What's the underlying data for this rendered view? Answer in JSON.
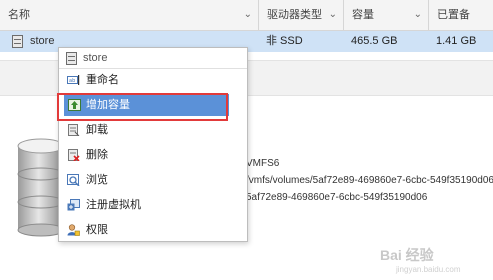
{
  "table": {
    "columns": [
      {
        "label": "名称"
      },
      {
        "label": "驱动器类型"
      },
      {
        "label": "容量"
      },
      {
        "label": "已置备"
      }
    ],
    "selected_row": {
      "name": "store",
      "drive_type": "非 SSD",
      "capacity": "465.5 GB",
      "provisioned": "1.41 GB"
    }
  },
  "details": {
    "type_fragment": "VMFS6",
    "path_fragment": "/vmfs/volumes/5af72e89-469860e7-6cbc-549f35190d06",
    "uuid_fragment": "5af72e89-469860e7-6cbc-549f35190d06"
  },
  "context_menu": {
    "header": "store",
    "items": [
      {
        "label": "重命名",
        "icon": "rename-icon"
      },
      {
        "label": "增加容量",
        "icon": "increase-capacity-icon",
        "active": true
      },
      {
        "label": "卸载",
        "icon": "unmount-icon"
      },
      {
        "label": "删除",
        "icon": "delete-icon"
      },
      {
        "label": "浏览",
        "icon": "browse-icon"
      },
      {
        "label": "注册虚拟机",
        "icon": "register-vm-icon"
      },
      {
        "label": "权限",
        "icon": "permissions-icon"
      }
    ]
  },
  "colors": {
    "selection": "#cfe2f6",
    "menu_active": "#5b91d8",
    "annotation_box": "#e23a3a"
  },
  "watermark": {
    "text": "Bai 经验",
    "sub": "jingyan.baidu.com"
  }
}
